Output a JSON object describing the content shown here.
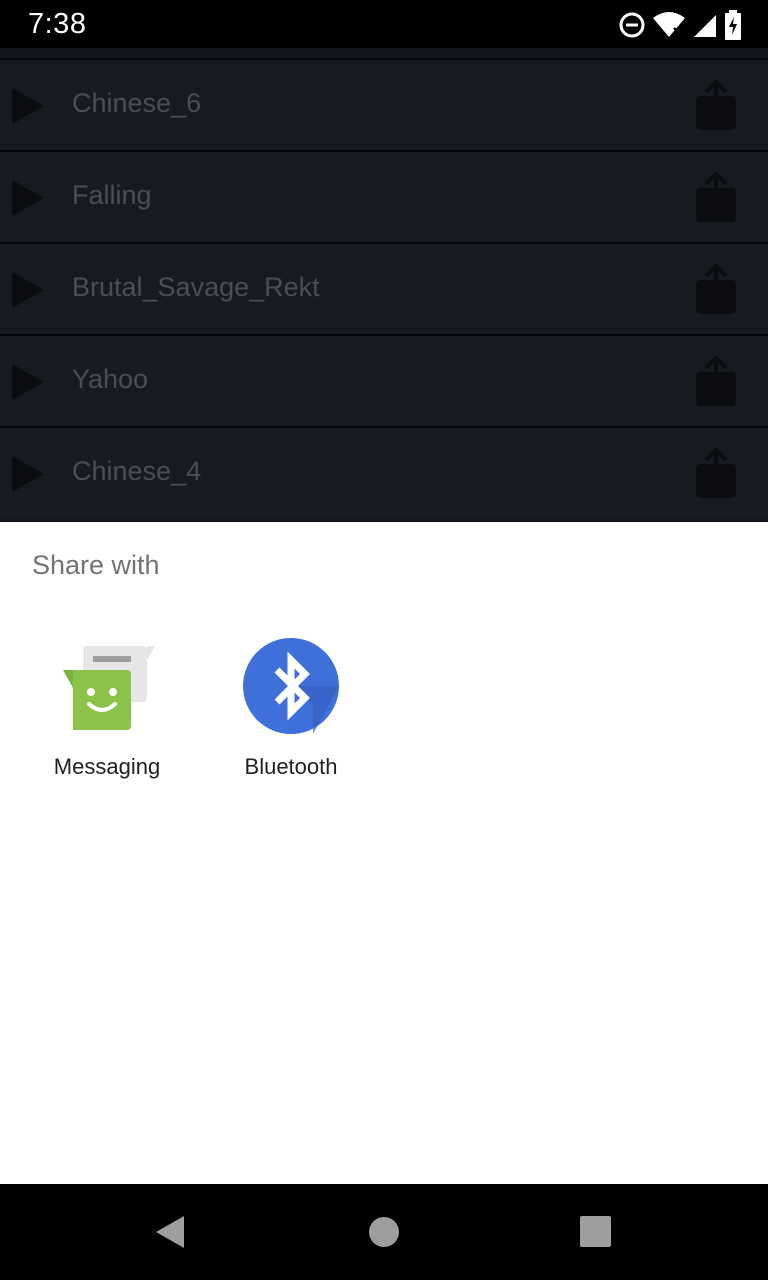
{
  "status_bar": {
    "time": "7:38",
    "icons": [
      "do-not-disturb-icon",
      "wifi-icon",
      "cell-signal-icon",
      "battery-charging-icon"
    ]
  },
  "sound_list": {
    "items": [
      {
        "label": "Chinese_6"
      },
      {
        "label": "Falling"
      },
      {
        "label": "Brutal_Savage_Rekt"
      },
      {
        "label": "Yahoo"
      },
      {
        "label": "Chinese_4"
      }
    ]
  },
  "share_sheet": {
    "title": "Share with",
    "targets": [
      {
        "label": "Messaging",
        "icon": "messaging-icon"
      },
      {
        "label": "Bluetooth",
        "icon": "bluetooth-icon"
      }
    ]
  },
  "nav_bar": {
    "buttons": [
      "back-icon",
      "home-icon",
      "recents-icon"
    ]
  },
  "colors": {
    "list_background": "#161a21",
    "sheet_background": "#ffffff",
    "bluetooth_blue": "#3f6fd8",
    "messaging_green": "#8bc34a"
  }
}
